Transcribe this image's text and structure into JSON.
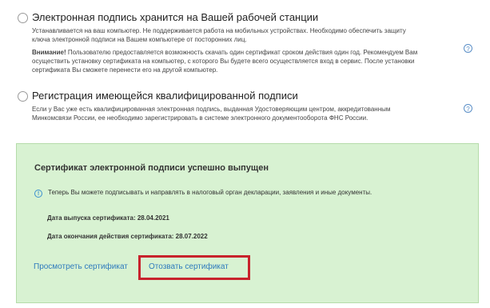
{
  "option_workstation": {
    "title": "Электронная подпись хранится на Вашей рабочей станции",
    "line1": "Устанавливается на ваш компьютер. Не поддерживается работа на мобильных устройствах. Необходимо обеспечить  защиту",
    "line2": "ключа электронной подписи на Вашем компьютере от посторонних лиц.",
    "warn_label": "Внимание!",
    "warn1": " Пользователю предоставляется возможность скачать  один сертификат  сроком действия один год. Рекомендуем Вам",
    "warn2": "осуществить установку сертификата на компьютер, с которого Вы будете всего осуществляется вход в сервис.  После установки",
    "warn3": "сертификата Вы сможете перенести его на другой  компьютер.",
    "help": "?"
  },
  "option_registration": {
    "title": "Регистрация имеющейся квалифицированной подписи",
    "line1": "Если у Вас уже есть квалифицированная электронная подпись, выданная Удостоверяющим центром, аккредитованным",
    "line2": "Минкомсвязи России, ее необходимо зарегистрировать в системе электронного документооборота ФНС России.",
    "help": "?"
  },
  "success": {
    "title": "Сертификат электронной подписи успешно выпущен",
    "info_icon": "!",
    "info_text": "Теперь Вы можете подписывать и направлять в налоговый орган декларации, заявления и иные документы.",
    "issue_date": "Дата выпуска сертификата: 28.04.2021",
    "expiry_date": "Дата окончания действия сертификата: 28.07.2022",
    "view_link": "Просмотреть сертификат",
    "revoke_link": "Отозвать сертификат"
  },
  "colors": {
    "success_background": "#d8f2d2",
    "link": "#2f7bbd",
    "highlight": "#c8232c"
  },
  "icons": [
    "help-icon",
    "info-icon"
  ]
}
